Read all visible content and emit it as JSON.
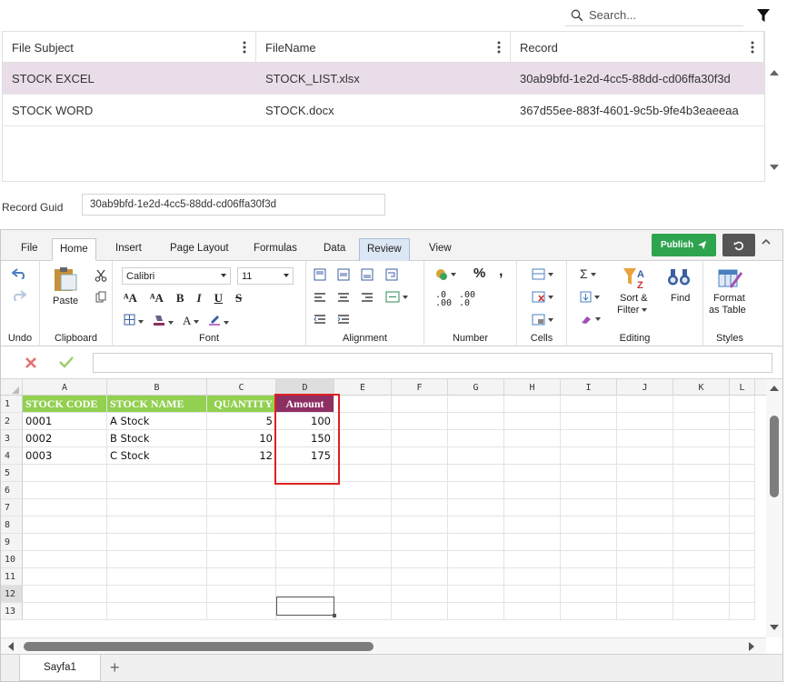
{
  "search": {
    "placeholder": "Search..."
  },
  "grid": {
    "columns": [
      "File Subject",
      "FileName",
      "Record"
    ],
    "rows": [
      {
        "subject": "STOCK EXCEL",
        "file": "STOCK_LIST.xlsx",
        "record": "30ab9bfd-1e2d-4cc5-88dd-cd06ffa30f3d",
        "selected": true
      },
      {
        "subject": "STOCK WORD",
        "file": "STOCK.docx",
        "record": "367d55ee-883f-4601-9c5b-9fe4b3eaeeaa",
        "selected": false
      }
    ]
  },
  "record_guid": {
    "label": "Record Guid",
    "value": "30ab9bfd-1e2d-4cc5-88dd-cd06ffa30f3d"
  },
  "ribbon": {
    "tabs": [
      "File",
      "Home",
      "Insert",
      "Page Layout",
      "Formulas",
      "Data",
      "Review",
      "View"
    ],
    "active_tab": "Home",
    "publish_label": "Publish",
    "groups": {
      "undo": "Undo",
      "clipboard": "Clipboard",
      "font": "Font",
      "alignment": "Alignment",
      "number": "Number",
      "cells": "Cells",
      "editing": "Editing",
      "styles": "Styles"
    },
    "paste_label": "Paste",
    "font_name": "Calibri",
    "font_size": "11",
    "sort_filter_label_1": "Sort &",
    "sort_filter_label_2": "Filter",
    "find_label": "Find",
    "format_table_label_1": "Format",
    "format_table_label_2": "as Table",
    "number_percent": "%",
    "number_comma": ","
  },
  "spreadsheet": {
    "columns": [
      "A",
      "B",
      "C",
      "D",
      "E",
      "F",
      "G",
      "H",
      "I",
      "J",
      "K",
      "L"
    ],
    "row_numbers": [
      "1",
      "2",
      "3",
      "4",
      "5",
      "6",
      "7",
      "8",
      "9",
      "10",
      "11",
      "12",
      "13"
    ],
    "header_row": [
      "STOCK CODE",
      "STOCK NAME",
      "QUANTITY",
      "Amount"
    ],
    "data_rows": [
      [
        "0001",
        "A Stock",
        "5",
        "100"
      ],
      [
        "0002",
        "B Stock",
        "10",
        "150"
      ],
      [
        "0003",
        "C Stock",
        "12",
        "175"
      ]
    ],
    "sheet_tab": "Sayfa1",
    "header_green": "#92d050",
    "header_purple": "#8e2f63",
    "highlight_red": "#e02020"
  }
}
